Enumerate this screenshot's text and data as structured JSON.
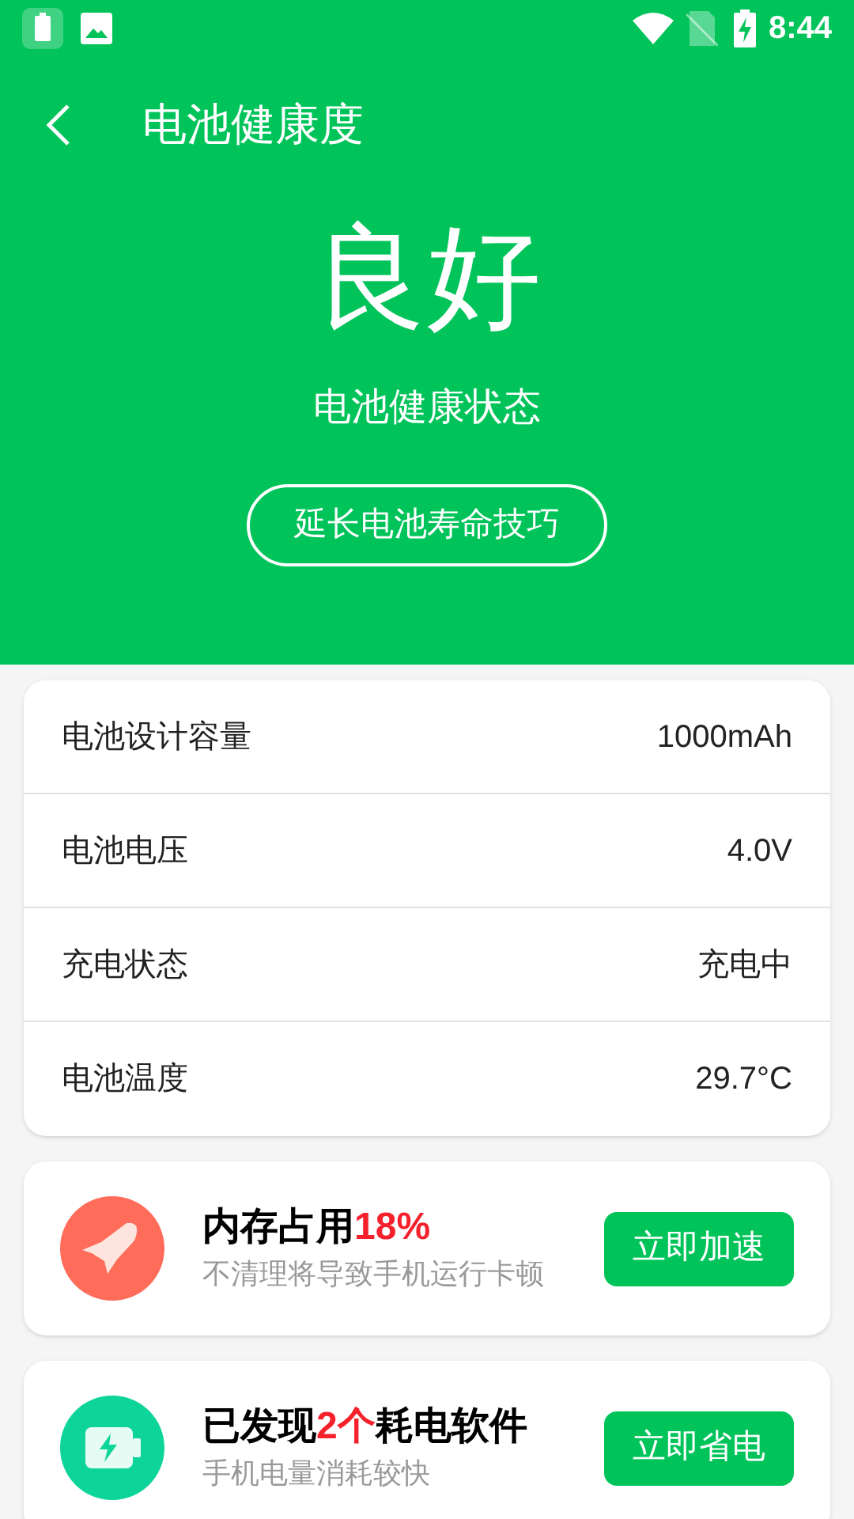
{
  "status_bar": {
    "time": "8:44"
  },
  "header": {
    "title": "电池健康度",
    "status": "良好",
    "status_label": "电池健康状态",
    "tips_button": "延长电池寿命技巧"
  },
  "info_rows": [
    {
      "label": "电池设计容量",
      "value": "1000mAh"
    },
    {
      "label": "电池电压",
      "value": "4.0V"
    },
    {
      "label": "充电状态",
      "value": "充电中"
    },
    {
      "label": "电池温度",
      "value": "29.7°C"
    }
  ],
  "action_cards": [
    {
      "kind": "memory",
      "title": [
        {
          "text": "内存占用",
          "highlight": false
        },
        {
          "text": "18%",
          "highlight": true
        }
      ],
      "subtitle": "不清理将导致手机运行卡顿",
      "button": "立即加速"
    },
    {
      "kind": "battery",
      "title": [
        {
          "text": "已发现",
          "highlight": false
        },
        {
          "text": "2个",
          "highlight": true
        },
        {
          "text": "耗电软件",
          "highlight": false
        }
      ],
      "subtitle": "手机电量消耗较快",
      "button": "立即省电"
    }
  ]
}
